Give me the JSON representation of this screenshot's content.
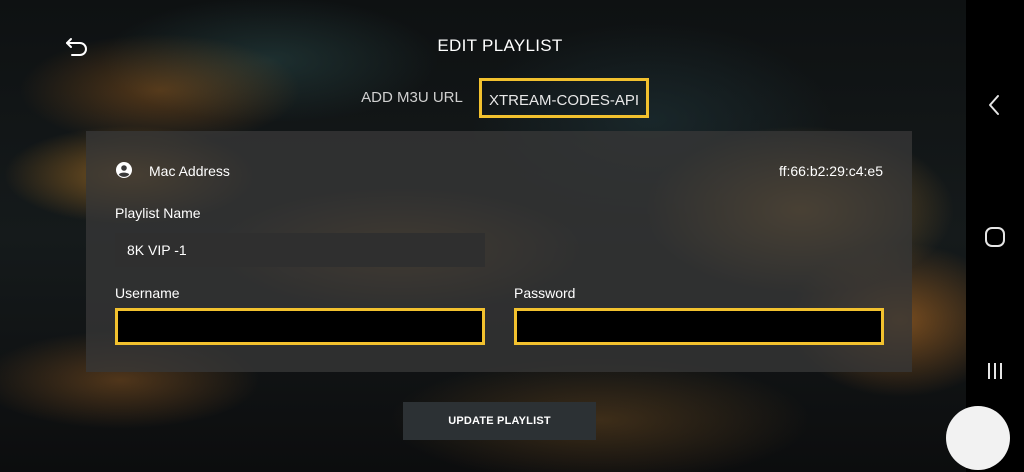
{
  "header": {
    "title": "EDIT PLAYLIST",
    "back_icon": "back-arrow-icon"
  },
  "tabs": [
    {
      "label": "ADD M3U URL",
      "selected": false
    },
    {
      "label": "XTREAM-CODES-API",
      "selected": true
    }
  ],
  "form": {
    "mac": {
      "label": "Mac Address",
      "value": "ff:66:b2:29:c4:e5",
      "icon": "user-circle-icon"
    },
    "playlist_name": {
      "label": "Playlist Name",
      "value": "8K VIP -1"
    },
    "username": {
      "label": "Username",
      "value": ""
    },
    "password": {
      "label": "Password",
      "value": ""
    },
    "submit_label": "UPDATE PLAYLIST"
  },
  "system_nav": {
    "back_icon": "chevron-left-icon",
    "home_icon": "circle-home-icon",
    "recent_icon": "recent-apps-icon"
  },
  "colors": {
    "highlight": "#f2c12e",
    "panel": "#373737",
    "button": "#2c3134"
  }
}
